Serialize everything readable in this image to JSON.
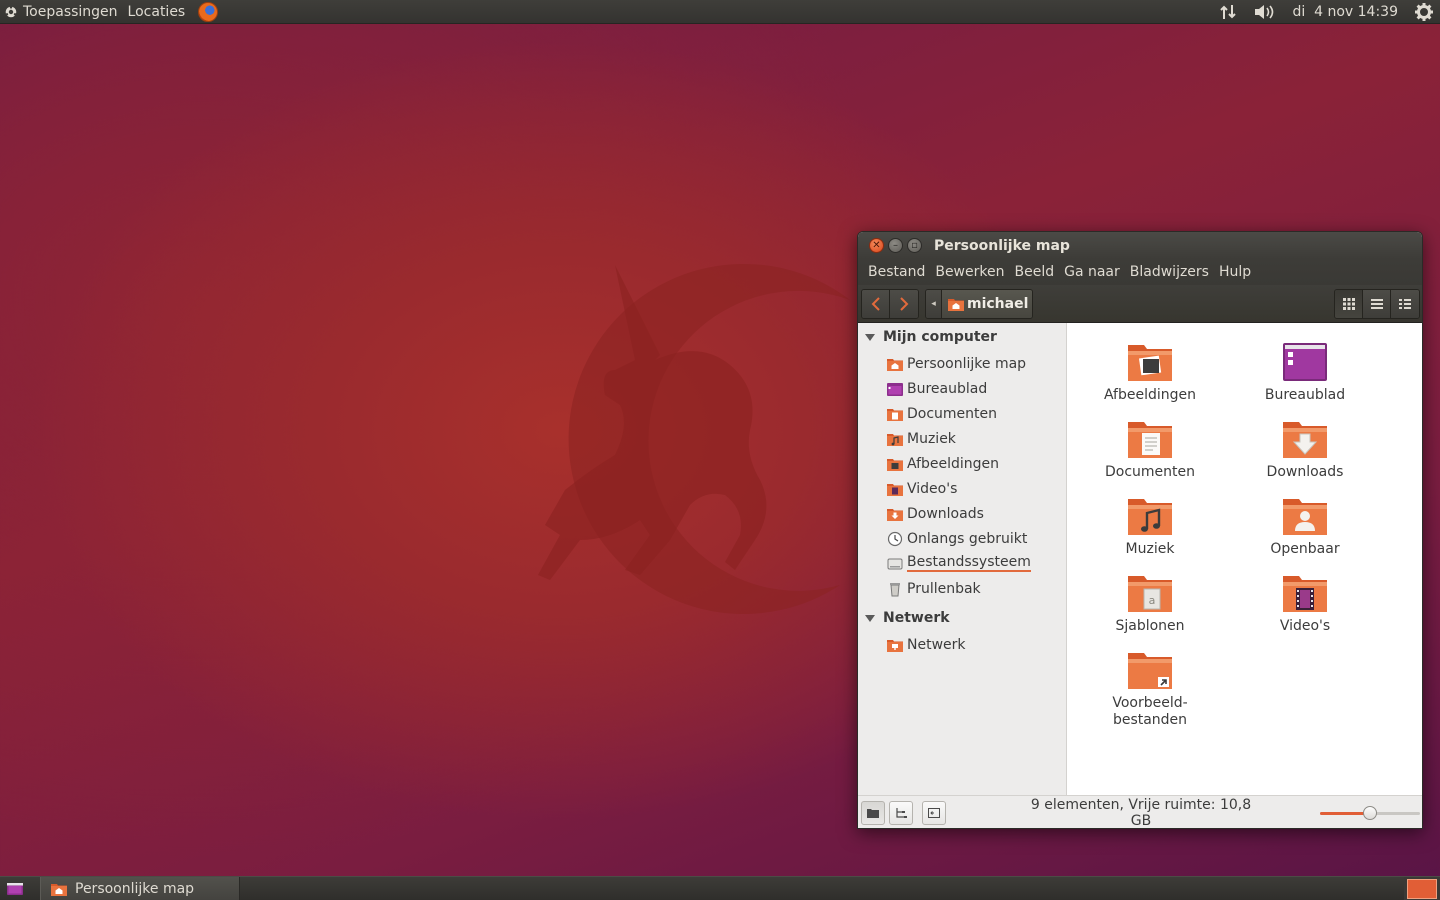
{
  "top_panel": {
    "applications": "Toepassingen",
    "places": "Locaties",
    "browser_icon": "firefox-icon",
    "network_icon": "network-arrows-icon",
    "volume_icon": "speaker-icon",
    "clock": "di  4 nov 14:39",
    "system_icon": "gear-icon"
  },
  "window": {
    "title": "Persoonlijke map",
    "menu": [
      "Bestand",
      "Bewerken",
      "Beeld",
      "Ga naar",
      "Bladwijzers",
      "Hulp"
    ],
    "breadcrumb": "michael",
    "sidebar": {
      "sections": [
        {
          "title": "Mijn computer",
          "items": [
            {
              "label": "Persoonlijke map",
              "icon": "home-folder-icon"
            },
            {
              "label": "Bureaublad",
              "icon": "desktop-folder-icon"
            },
            {
              "label": "Documenten",
              "icon": "documents-folder-icon"
            },
            {
              "label": "Muziek",
              "icon": "music-folder-icon"
            },
            {
              "label": "Afbeeldingen",
              "icon": "pictures-folder-icon"
            },
            {
              "label": "Video's",
              "icon": "videos-folder-icon"
            },
            {
              "label": "Downloads",
              "icon": "downloads-folder-icon"
            },
            {
              "label": "Onlangs gebruikt",
              "icon": "recent-icon"
            },
            {
              "label": "Bestandssysteem",
              "icon": "drive-icon"
            },
            {
              "label": "Prullenbak",
              "icon": "trash-icon"
            }
          ]
        },
        {
          "title": "Netwerk",
          "items": [
            {
              "label": "Netwerk",
              "icon": "network-folder-icon"
            }
          ]
        }
      ]
    },
    "files": [
      {
        "label": "Afbeeldingen",
        "icon": "pictures-folder-icon"
      },
      {
        "label": "Bureaublad",
        "icon": "desktop-folder-icon"
      },
      {
        "label": "Documenten",
        "icon": "documents-folder-icon"
      },
      {
        "label": "Downloads",
        "icon": "downloads-folder-icon"
      },
      {
        "label": "Muziek",
        "icon": "music-folder-icon"
      },
      {
        "label": "Openbaar",
        "icon": "public-folder-icon"
      },
      {
        "label": "Sjablonen",
        "icon": "templates-folder-icon"
      },
      {
        "label": "Video's",
        "icon": "videos-folder-icon"
      },
      {
        "label": "Voorbeeld-\nbestanden",
        "icon": "examples-folder-icon"
      }
    ],
    "status": "9 elementen, Vrije ruimte: 10,8 GB",
    "zoom_level": 0.5
  },
  "bottom_panel": {
    "task_label": "Persoonlijke map"
  },
  "colors": {
    "accent": "#e15e36",
    "folder": "#e8733e",
    "panel": "#3c3b37"
  }
}
